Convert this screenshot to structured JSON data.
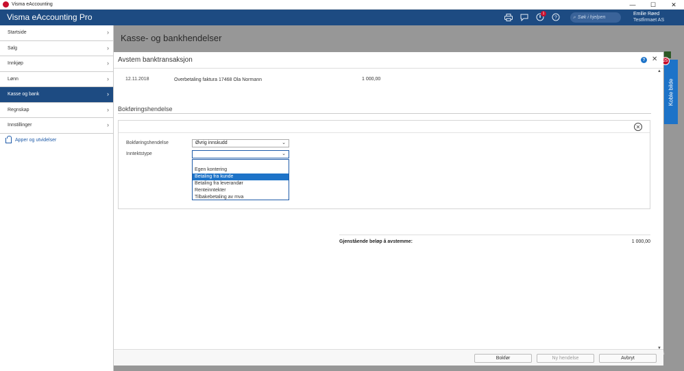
{
  "window": {
    "title": "Visma eAccounting",
    "minimize": "—",
    "maximize": "☐",
    "close": "✕"
  },
  "header": {
    "brand": "Visma eAccounting Pro",
    "search_placeholder": "Søk i hjelpen",
    "notification_count": "1",
    "user_name": "Emilie Røed",
    "company": "Testfirmaet AS"
  },
  "sidebar": {
    "items": [
      {
        "label": "Startside",
        "active": false
      },
      {
        "label": "Salg",
        "active": false
      },
      {
        "label": "Innkjøp",
        "active": false
      },
      {
        "label": "Lønn",
        "active": false
      },
      {
        "label": "Kasse og bank",
        "active": true
      },
      {
        "label": "Regnskap",
        "active": false
      },
      {
        "label": "Innstillinger",
        "active": false
      }
    ],
    "apps_link": "Apper og utvidelser"
  },
  "page": {
    "title": "Kasse- og bankhendelser"
  },
  "side_tab": {
    "label": "Koble bilde",
    "badge": "25"
  },
  "modal": {
    "title": "Avstem banktransaksjon",
    "transaction": {
      "date": "12.11.2018",
      "description": "Overbetaling faktura 17468 Ola Normann",
      "amount": "1 000,00"
    },
    "section_title": "Bokføringshendelse",
    "form": {
      "event_label": "Bokføringshendelse",
      "event_value": "Øvrig innskudd",
      "income_type_label": "Inntektstype",
      "income_type_value": "",
      "income_type_options": [
        "",
        "Egen kontering",
        "Betaling fra kunde",
        "Betaling fra leverandør",
        "Renteinntekter",
        "Tilbakebetaling av mva"
      ],
      "highlighted_option": "Betaling fra kunde"
    },
    "remaining_label": "Gjenstående beløp å avstemme:",
    "remaining_value": "1 000,00",
    "buttons": {
      "post": "Bokfør",
      "new_event": "Ny hendelse",
      "cancel": "Avbryt"
    }
  },
  "colors": {
    "brand": "#1d4b82",
    "accent": "#1d73c8",
    "badge": "#c8102e"
  }
}
